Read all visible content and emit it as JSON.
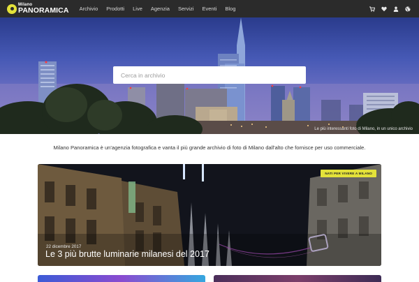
{
  "header": {
    "logo_small": "Milano",
    "logo_big": "PANORAMICA",
    "nav": [
      "Archivio",
      "Prodotti",
      "Live",
      "Agenzia",
      "Servizi",
      "Eventi",
      "Blog"
    ],
    "icons": [
      "cart-icon",
      "heart-icon",
      "user-icon",
      "globe-icon"
    ]
  },
  "hero": {
    "search_placeholder": "Cerca in archivio",
    "caption": "Le più interessanti foto di Milano, in un unico archivio"
  },
  "intro": {
    "text": "Milano Panoramica è un'agenzia fotografica e vanta il più grande archivio di foto di Milano dall'alto che fornisce per uso commerciale."
  },
  "featured": {
    "badge": "NATI PER VIVERE A MILANO",
    "date": "22 dicembre 2017",
    "title": "Le 3 più brutte luminarie milanesi del 2017"
  },
  "colors": {
    "accent": "#e4e23a",
    "topbar": "#2b2b2b",
    "text": "#333333"
  }
}
